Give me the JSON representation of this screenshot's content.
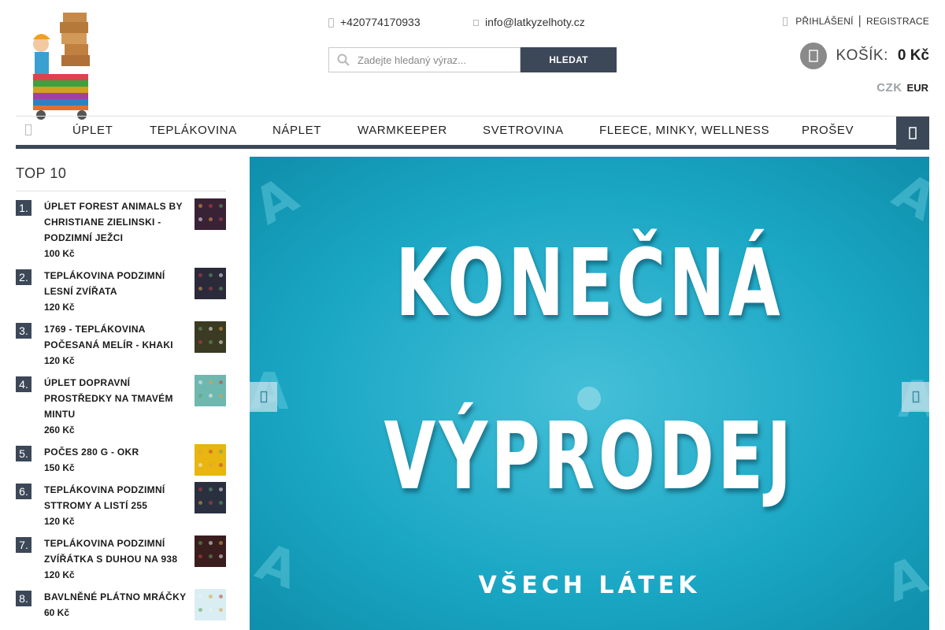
{
  "header": {
    "phone": "+420774170933",
    "email": "info@latkyzelhoty.cz",
    "search_placeholder": "Zadejte hledaný výraz...",
    "search_button": "HLEDAT",
    "login": "PŘIHLÁŠENÍ",
    "separator": "|",
    "register": "REGISTRACE",
    "cart_label": "KOŠÍK:",
    "cart_total": "0 Kč",
    "currency_czk": "CZK",
    "currency_eur": "EUR"
  },
  "nav": {
    "items": [
      "ÚPLET",
      "TEPLÁKOVINA",
      "NÁPLET",
      "WARMKEEPER",
      "SVETROVINA",
      "FLEECE, MINKY, WELLNESS",
      "PROŠEV"
    ]
  },
  "sidebar": {
    "title": "TOP 10",
    "items": [
      {
        "rank": "1.",
        "name": "ÚPLET FOREST ANIMALS BY CHRISTIANE ZIELINSKI - PODZIMNÍ JEŽCI",
        "price": "100 Kč",
        "thumb_color": "#3a2236"
      },
      {
        "rank": "2.",
        "name": "TEPLÁKOVINA PODZIMNÍ LESNÍ ZVÍŘATA",
        "price": "120 Kč",
        "thumb_color": "#2b2a3a"
      },
      {
        "rank": "3.",
        "name": "1769 - TEPLÁKOVINA POČESANÁ MELÍR - KHAKI",
        "price": "120 Kč",
        "thumb_color": "#3b3a22"
      },
      {
        "rank": "4.",
        "name": "ÚPLET DOPRAVNÍ PROSTŘEDKY NA TMAVÉM MINTU",
        "price": "260 Kč",
        "thumb_color": "#6fb8b0"
      },
      {
        "rank": "5.",
        "name": "POČES 280 G - OKR",
        "price": "150 Kč",
        "thumb_color": "#e8b511"
      },
      {
        "rank": "6.",
        "name": "TEPLÁKOVINA PODZIMNÍ STTROMY A LISTÍ 255",
        "price": "120 Kč",
        "thumb_color": "#2a3040"
      },
      {
        "rank": "7.",
        "name": "TEPLÁKOVINA PODZIMNÍ ZVÍŘÁTKA S DUHOU NA 938",
        "price": "120 Kč",
        "thumb_color": "#3a1e1e"
      },
      {
        "rank": "8.",
        "name": "BAVLNĚNÉ PLÁTNO MRÁČKY",
        "price": "60 Kč",
        "thumb_color": "#d9eef2"
      }
    ]
  },
  "banner": {
    "line1": "KONEČNÁ",
    "line2": "VÝPRODEJ",
    "line3": "VŠECH LÁTEK",
    "bg_color": "#1aa7c4"
  },
  "colors": {
    "primary": "#3c4858",
    "banner": "#1aa7c4"
  }
}
